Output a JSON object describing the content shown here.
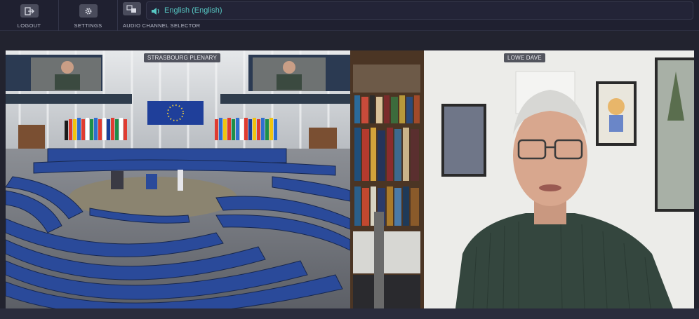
{
  "toolbar": {
    "logout_label": "LOGOUT",
    "settings_label": "SETTINGS",
    "audio_channel_label": "AUDIO CHANNEL SELECTOR",
    "audio_channel_value": "English (English)",
    "accent_color": "#57c7c3"
  },
  "icons": {
    "logout": "logout-icon",
    "settings": "gear-icon",
    "audio_channel": "language-icon",
    "speaker": "speaker-icon"
  },
  "video": {
    "left_tile_label": "STRASBOURG PLENARY",
    "right_tile_label": "LOWE DAVE"
  }
}
